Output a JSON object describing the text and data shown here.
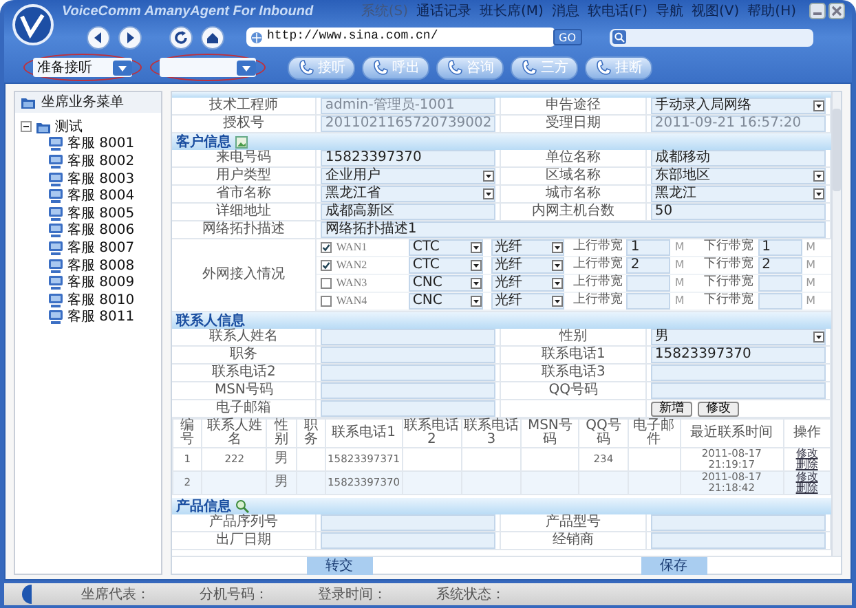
{
  "app": {
    "title": "VoiceComm AmanyAgent For Inbound"
  },
  "menu": [
    {
      "label": "系统(S)",
      "disabled": true
    },
    {
      "label": "通话记录",
      "disabled": false
    },
    {
      "label": "班长席(M)",
      "disabled": false
    },
    {
      "label": "消息",
      "disabled": false
    },
    {
      "label": "软电话(F)",
      "disabled": false
    },
    {
      "label": "导航",
      "disabled": false
    },
    {
      "label": "视图(V)",
      "disabled": false
    },
    {
      "label": "帮助(H)",
      "disabled": false
    }
  ],
  "address_bar": {
    "url": "http://www.sina.com.cn/",
    "go": "GO"
  },
  "status_select": {
    "value": "准备接听"
  },
  "call_buttons": [
    "接听",
    "呼出",
    "咨询",
    "三方",
    "挂断"
  ],
  "sidebar": {
    "title": "坐席业务菜单",
    "tree": [
      {
        "label": "测试",
        "expanded": true,
        "children": [
          {
            "label": "客服 8001"
          },
          {
            "label": "客服 8002"
          },
          {
            "label": "客服 8003"
          },
          {
            "label": "客服 8004"
          },
          {
            "label": "客服 8005"
          },
          {
            "label": "客服 8006"
          },
          {
            "label": "客服 8007"
          },
          {
            "label": "客服 8008"
          },
          {
            "label": "客服 8009"
          },
          {
            "label": "客服 8010"
          },
          {
            "label": "客服 8011"
          }
        ]
      }
    ]
  },
  "sections": [
    {
      "rows": [
        {
          "kind": "pair",
          "fields": [
            {
              "label": "技术工程师",
              "kind": "readonly",
              "value": "admin-管理员-1001"
            },
            {
              "label": "申告途径",
              "kind": "select",
              "value": "手动录入局网络"
            }
          ]
        },
        {
          "kind": "pair",
          "fields": [
            {
              "label": "授权号",
              "kind": "readonly",
              "value": "2011021165720739002"
            },
            {
              "label": "受理日期",
              "kind": "readonly",
              "value": "2011-09-21 16:57:20"
            }
          ]
        }
      ]
    },
    {
      "title": "客户信息",
      "rows": [
        {
          "kind": "pair",
          "fields": [
            {
              "label": "来电号码",
              "kind": "input",
              "value": "15823397370"
            },
            {
              "label": "单位名称",
              "kind": "input",
              "value": "成都移动"
            }
          ]
        },
        {
          "kind": "pair",
          "fields": [
            {
              "label": "用户类型",
              "kind": "select",
              "value": "企业用户"
            },
            {
              "label": "区域名称",
              "kind": "select",
              "value": "东部地区"
            }
          ]
        },
        {
          "kind": "pair",
          "fields": [
            {
              "label": "省市名称",
              "kind": "select",
              "value": "黑龙江省"
            },
            {
              "label": "城市名称",
              "kind": "select",
              "value": "黑龙江"
            }
          ]
        },
        {
          "kind": "pair",
          "fields": [
            {
              "label": "详细地址",
              "kind": "input",
              "value": "成都高新区"
            },
            {
              "label": "内网主机台数",
              "kind": "input",
              "value": "50"
            }
          ]
        },
        {
          "kind": "wide",
          "fields": [
            {
              "label": "网络拓扑描述",
              "kind": "input",
              "value": "网络拓扑描述1"
            }
          ]
        },
        {
          "kind": "wan",
          "label": "外网接入情况",
          "lines": [
            {
              "name": "WAN1",
              "checked": true,
              "carrier": "CTC",
              "medium": "光纤",
              "up_label": "上行带宽",
              "up": "1",
              "up_unit": "M",
              "down_label": "下行带宽",
              "down": "1",
              "down_unit": "M"
            },
            {
              "name": "WAN2",
              "checked": true,
              "carrier": "CTC",
              "medium": "光纤",
              "up_label": "上行带宽",
              "up": "2",
              "up_unit": "M",
              "down_label": "下行带宽",
              "down": "2",
              "down_unit": "M"
            },
            {
              "name": "WAN3",
              "checked": false,
              "carrier": "CNC",
              "medium": "光纤",
              "up_label": "上行带宽",
              "up_unit": "M",
              "down_label": "下行带宽",
              "down_unit": "M"
            },
            {
              "name": "WAN4",
              "checked": false,
              "carrier": "CNC",
              "medium": "光纤",
              "up_label": "上行带宽",
              "up_unit": "M",
              "down_label": "下行带宽",
              "down_unit": "M"
            }
          ]
        }
      ]
    },
    {
      "title": "联系人信息",
      "rows": [
        {
          "kind": "pair",
          "fields": [
            {
              "label": "联系人姓名",
              "kind": "input"
            },
            {
              "label": "性别",
              "kind": "select",
              "value": "男"
            }
          ]
        },
        {
          "kind": "pair",
          "fields": [
            {
              "label": "职务",
              "kind": "input"
            },
            {
              "label": "联系电话1",
              "kind": "input",
              "value": "15823397370"
            }
          ]
        },
        {
          "kind": "pair",
          "fields": [
            {
              "label": "联系电话2",
              "kind": "input"
            },
            {
              "label": "联系电话3",
              "kind": "input"
            }
          ]
        },
        {
          "kind": "pair",
          "fields": [
            {
              "label": "MSN号码",
              "kind": "input"
            },
            {
              "label": "QQ号码",
              "kind": "input"
            }
          ]
        },
        {
          "kind": "pair_buttons",
          "fields": [
            {
              "label": "电子邮箱",
              "kind": "input"
            }
          ],
          "buttons": [
            "新增",
            "修改"
          ]
        },
        {
          "kind": "table",
          "columns": [
            "编号",
            "联系人姓名",
            "性别",
            "职务",
            "联系电话1",
            "联系电话2",
            "联系电话3",
            "MSN号码",
            "QQ号码",
            "电子邮件",
            "最近联系时间",
            "操作"
          ],
          "rows": [
            {
              "cells": [
                "1",
                "222",
                "男",
                null,
                "15823397371",
                null,
                null,
                null,
                "234",
                null,
                "2011-08-17 21:19:17"
              ],
              "actions": [
                "修改",
                "删除"
              ]
            },
            {
              "cells": [
                "2",
                null,
                "男",
                null,
                "15823397370",
                null,
                null,
                null,
                null,
                null,
                "2011-08-17 21:18:42"
              ],
              "actions": [
                "修改",
                "删除"
              ]
            }
          ]
        }
      ]
    },
    {
      "title": "产品信息",
      "rows": [
        {
          "kind": "pair",
          "fields": [
            {
              "label": "产品序列号",
              "kind": "input"
            },
            {
              "label": "产品型号",
              "kind": "input"
            }
          ]
        },
        {
          "kind": "pair",
          "fields": [
            {
              "label": "出厂日期",
              "kind": "input"
            },
            {
              "label": "经销商",
              "kind": "input"
            }
          ]
        }
      ]
    }
  ],
  "footer_buttons": [
    "转交",
    "保存"
  ],
  "status_bar": [
    "坐席代表：",
    "分机号码：",
    "登录时间：",
    "系统状态："
  ]
}
